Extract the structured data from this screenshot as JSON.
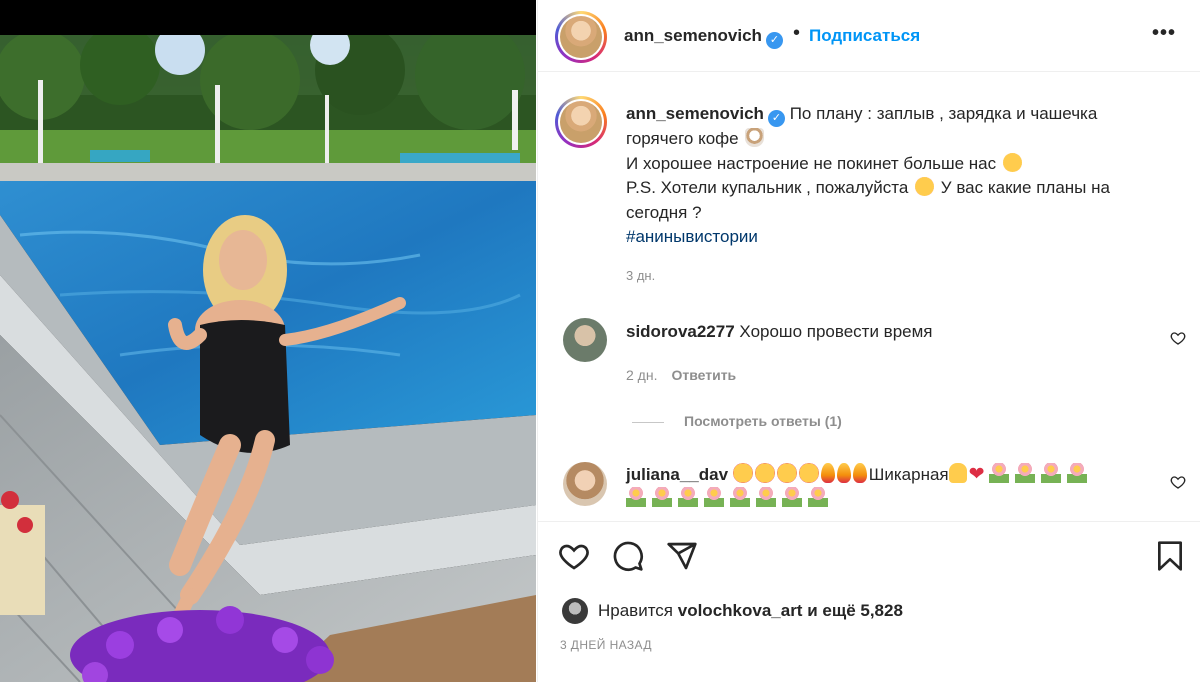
{
  "post": {
    "username": "ann_semenovich",
    "follow_label": "Подписаться",
    "more_label": "•••",
    "dot": "•",
    "verified_mark": "✓"
  },
  "caption": {
    "username": "ann_semenovich",
    "line1a": "По плану : заплыв , зарядка и чашечка",
    "line1b": "горячего кофе",
    "line2": "И хорошее настроение не покинет больше нас",
    "line3a": "P.S. Хотели купальник , пожалуйста",
    "line3b": "У вас какие планы на",
    "line3c": "сегодня ?",
    "hashtag": "#анинывистории",
    "time": "3 дн."
  },
  "comments": [
    {
      "username": "sidorova2277",
      "text": "Хорошо провести время",
      "time": "2 дн.",
      "reply_label": "Ответить"
    },
    {
      "username": "juliana__dav",
      "text": "Шикарная"
    }
  ],
  "view_replies": "Посмотреть ответы (1)",
  "likes": {
    "prefix": "Нравится",
    "user": "volochkova_art",
    "suffix": "и ещё 5,828"
  },
  "date": "3 ДНЕЙ НАЗАД",
  "colors": {
    "accent": "#0095f6",
    "verified": "#3897f0",
    "secondary_text": "#8e8e8e"
  }
}
